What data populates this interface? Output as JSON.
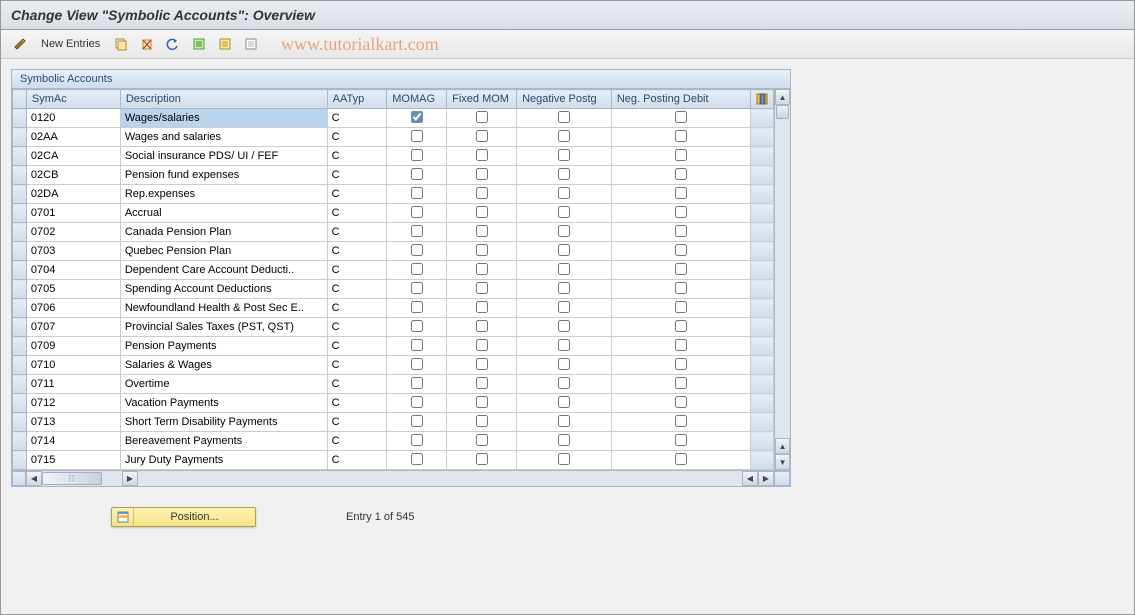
{
  "title": "Change View \"Symbolic Accounts\": Overview",
  "toolbar": {
    "new_entries": "New Entries"
  },
  "watermark": "www.tutorialkart.com",
  "panel": {
    "header": "Symbolic Accounts"
  },
  "columns": {
    "symac": "SymAc",
    "description": "Description",
    "aatyp": "AATyp",
    "momag": "MOMAG",
    "fixed_mom": "Fixed MOM",
    "negative_postg": "Negative Postg",
    "neg_posting_debit": "Neg. Posting Debit"
  },
  "rows": [
    {
      "symac": "0120",
      "desc": "Wages/salaries",
      "aatyp": "C",
      "momag": true,
      "fixed": false,
      "neg": false,
      "negd": false,
      "selected": true
    },
    {
      "symac": "02AA",
      "desc": "Wages and salaries",
      "aatyp": "C",
      "momag": false,
      "fixed": false,
      "neg": false,
      "negd": false
    },
    {
      "symac": "02CA",
      "desc": "Social insurance PDS/ UI / FEF",
      "aatyp": "C",
      "momag": false,
      "fixed": false,
      "neg": false,
      "negd": false
    },
    {
      "symac": "02CB",
      "desc": "Pension fund expenses",
      "aatyp": "C",
      "momag": false,
      "fixed": false,
      "neg": false,
      "negd": false
    },
    {
      "symac": "02DA",
      "desc": "Rep.expenses",
      "aatyp": "C",
      "momag": false,
      "fixed": false,
      "neg": false,
      "negd": false
    },
    {
      "symac": "0701",
      "desc": "Accrual",
      "aatyp": "C",
      "momag": false,
      "fixed": false,
      "neg": false,
      "negd": false
    },
    {
      "symac": "0702",
      "desc": "Canada Pension Plan",
      "aatyp": "C",
      "momag": false,
      "fixed": false,
      "neg": false,
      "negd": false
    },
    {
      "symac": "0703",
      "desc": "Quebec Pension Plan",
      "aatyp": "C",
      "momag": false,
      "fixed": false,
      "neg": false,
      "negd": false
    },
    {
      "symac": "0704",
      "desc": "Dependent Care Account Deducti..",
      "aatyp": "C",
      "momag": false,
      "fixed": false,
      "neg": false,
      "negd": false
    },
    {
      "symac": "0705",
      "desc": "Spending Account Deductions",
      "aatyp": "C",
      "momag": false,
      "fixed": false,
      "neg": false,
      "negd": false
    },
    {
      "symac": "0706",
      "desc": "Newfoundland Health & Post Sec E..",
      "aatyp": "C",
      "momag": false,
      "fixed": false,
      "neg": false,
      "negd": false
    },
    {
      "symac": "0707",
      "desc": "Provincial Sales Taxes (PST, QST)",
      "aatyp": "C",
      "momag": false,
      "fixed": false,
      "neg": false,
      "negd": false
    },
    {
      "symac": "0709",
      "desc": "Pension Payments",
      "aatyp": "C",
      "momag": false,
      "fixed": false,
      "neg": false,
      "negd": false
    },
    {
      "symac": "0710",
      "desc": "Salaries & Wages",
      "aatyp": "C",
      "momag": false,
      "fixed": false,
      "neg": false,
      "negd": false
    },
    {
      "symac": "0711",
      "desc": "Overtime",
      "aatyp": "C",
      "momag": false,
      "fixed": false,
      "neg": false,
      "negd": false
    },
    {
      "symac": "0712",
      "desc": "Vacation Payments",
      "aatyp": "C",
      "momag": false,
      "fixed": false,
      "neg": false,
      "negd": false
    },
    {
      "symac": "0713",
      "desc": "Short Term Disability Payments",
      "aatyp": "C",
      "momag": false,
      "fixed": false,
      "neg": false,
      "negd": false
    },
    {
      "symac": "0714",
      "desc": "Bereavement Payments",
      "aatyp": "C",
      "momag": false,
      "fixed": false,
      "neg": false,
      "negd": false
    },
    {
      "symac": "0715",
      "desc": "Jury Duty Payments",
      "aatyp": "C",
      "momag": false,
      "fixed": false,
      "neg": false,
      "negd": false
    }
  ],
  "footer": {
    "position_label": "Position...",
    "entry_text": "Entry 1 of 545"
  }
}
